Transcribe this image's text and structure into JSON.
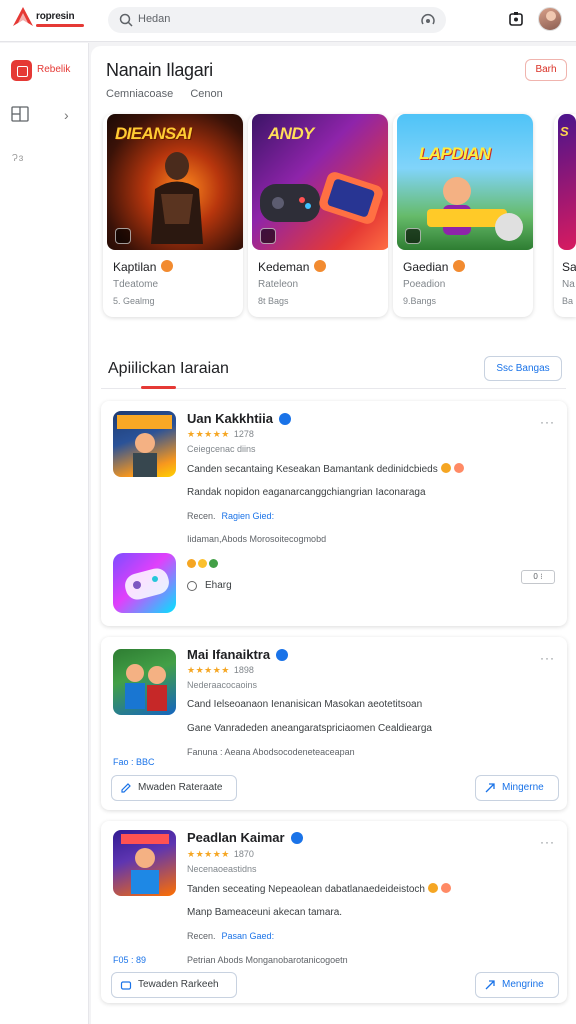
{
  "header": {
    "logo_text": "ropresin",
    "search_placeholder": "Hedan"
  },
  "sidebar": {
    "apps_label": "Rebelik",
    "games_label": "Ɂɜ"
  },
  "featured": {
    "title": "Nanain Ilagari",
    "button": "Barh",
    "tabs": [
      "Cemniacoase",
      "Cenon"
    ],
    "cards": [
      {
        "thumb_title": "DIEANSAI",
        "name": "Kaptilan",
        "dev": "Tdeatome",
        "rating": "5. Gealmg"
      },
      {
        "thumb_title": "ANDY",
        "name": "Kedeman",
        "dev": "Rateleon",
        "rating": "8t Bags"
      },
      {
        "thumb_title": "LAPDIAN",
        "name": "Gaedian",
        "dev": "Poeadion",
        "rating": "9.Bangs"
      },
      {
        "thumb_title": "S",
        "name": "Sa",
        "dev": "Na",
        "rating": "Ba"
      }
    ]
  },
  "applications": {
    "title": "Apiilickan Iaraian",
    "button": "Ssc Bangas",
    "items": [
      {
        "title": "Uan Kakkhtiia",
        "rating": "1278",
        "sub": "Ceiegcenac diins",
        "desc1": "Canden secantaing Keseakan Bamantank dedinidcbieds",
        "desc2": "Randak nopidon eaganarcanggchiangrian Iaconaraga",
        "meta": "Recen.",
        "meta_link": "Ragien Gied:",
        "link": "Iidaman,Abods Morosoitecogmobd",
        "sub_app": "Eharg",
        "ctl": "0 ⁝"
      },
      {
        "title": "Mai Ifanaiktra",
        "rating": "1898",
        "sub": "Nederaacocaoins",
        "desc1": "Cand Ielseoanaon Ienanisican Masokan aeotetitsoan",
        "desc2": "Gane Vanradeden aneangaratspriciaomen Cealdiearga",
        "left_link": "Fao : BBC",
        "link": "Fanuna : Aeana Abodsocodeneteaceapan",
        "btn_left": "Mwaden Rateraate",
        "btn_right": "Mingerne"
      },
      {
        "title": "Peadlan Kaimar",
        "rating": "1870",
        "sub": "Necenaoeastidns",
        "desc1": "Tanden seceating Nepeaolean dabatlanaedeideistoch",
        "desc2": "Manp Bameaceuni akecan tamara.",
        "meta": "Recen.",
        "meta_link": "Pasan Gaed:",
        "left_link": "F05 : 89",
        "link": "Petrian Abods Monganobarotanicogoetn",
        "btn_left": "Tewaden Rarkeeh",
        "btn_right": "Mengrine"
      }
    ]
  }
}
